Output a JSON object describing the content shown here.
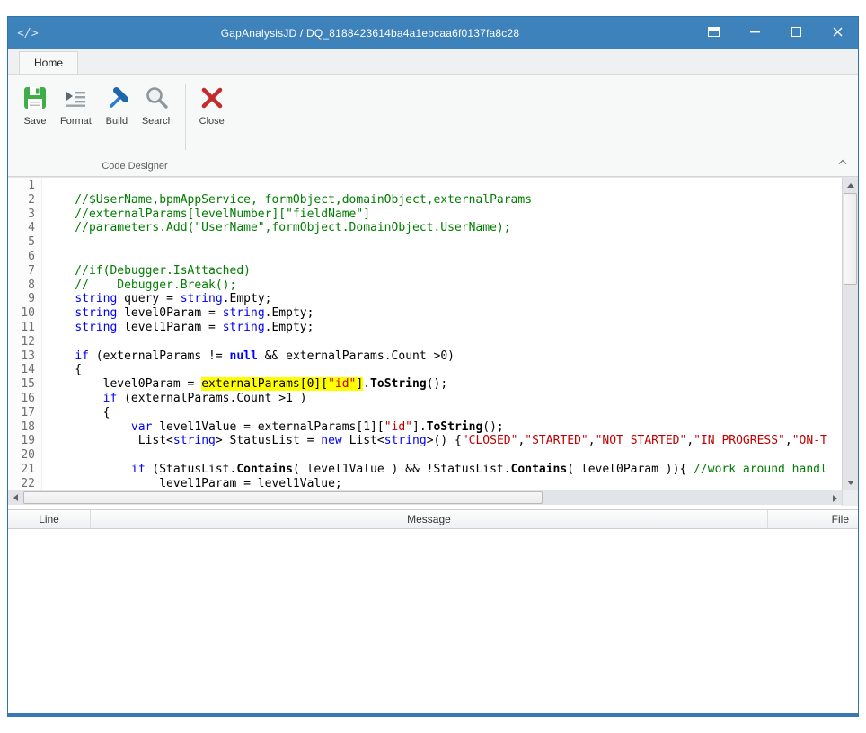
{
  "window": {
    "title": "GapAnalysisJD / DQ_8188423614ba4a1ebcaa6f0137fa8c28",
    "app_icon": "code-glyph",
    "app_icon_glyph": "</>",
    "controls": [
      {
        "name": "window-mode"
      },
      {
        "name": "minimize"
      },
      {
        "name": "maximize"
      },
      {
        "name": "close"
      }
    ]
  },
  "ribbon": {
    "tab": "Home",
    "group_label": "Code Designer",
    "buttons": [
      {
        "label": "Save",
        "icon": "floppy-disk-icon"
      },
      {
        "label": "Format",
        "icon": "format-lines-icon"
      },
      {
        "label": "Build",
        "icon": "hammer-icon"
      },
      {
        "label": "Search",
        "icon": "magnifier-icon"
      },
      {
        "label": "Close",
        "icon": "red-x-icon"
      }
    ]
  },
  "editor": {
    "highlight_color": "#ffff00",
    "lines": [
      [],
      [
        [
          "c",
          "    //$UserName,bpmAppService, formObject,domainObject,externalParams"
        ]
      ],
      [
        [
          "c",
          "    //externalParams[levelNumber][\"fieldName\"]"
        ]
      ],
      [
        [
          "c",
          "    //parameters.Add(\"UserName\",formObject.DomainObject.UserName);"
        ]
      ],
      [],
      [],
      [
        [
          "c",
          "    //if(Debugger.IsAttached)"
        ]
      ],
      [
        [
          "c",
          "    //    Debugger.Break();"
        ]
      ],
      [
        [
          "",
          "    "
        ],
        [
          "k",
          "string"
        ],
        [
          "",
          " query = "
        ],
        [
          "k",
          "string"
        ],
        [
          "",
          ".Empty;"
        ]
      ],
      [
        [
          "",
          "    "
        ],
        [
          "k",
          "string"
        ],
        [
          "",
          " level0Param = "
        ],
        [
          "k",
          "string"
        ],
        [
          "",
          ".Empty;"
        ]
      ],
      [
        [
          "",
          "    "
        ],
        [
          "k",
          "string"
        ],
        [
          "",
          " level1Param = "
        ],
        [
          "k",
          "string"
        ],
        [
          "",
          ".Empty;"
        ]
      ],
      [],
      [
        [
          "",
          "    "
        ],
        [
          "k",
          "if"
        ],
        [
          "",
          " (externalParams != "
        ],
        [
          "kb",
          "null"
        ],
        [
          "",
          " && externalParams.Count >0)"
        ]
      ],
      [
        [
          "",
          "    {"
        ]
      ],
      [
        [
          "",
          "        level0Param = "
        ],
        [
          "h",
          "externalParams[0]["
        ],
        [
          "hs",
          "\"id\""
        ],
        [
          "h",
          "]"
        ],
        [
          "",
          "."
        ],
        [
          "m",
          "ToString"
        ],
        [
          "",
          "();"
        ]
      ],
      [
        [
          "",
          "        "
        ],
        [
          "k",
          "if"
        ],
        [
          "",
          " (externalParams.Count >1 )"
        ]
      ],
      [
        [
          "",
          "        {"
        ]
      ],
      [
        [
          "",
          "            "
        ],
        [
          "k",
          "var"
        ],
        [
          "",
          " level1Value = externalParams[1]["
        ],
        [
          "s",
          "\"id\""
        ],
        [
          "",
          "]."
        ],
        [
          "m",
          "ToString"
        ],
        [
          "",
          "();"
        ]
      ],
      [
        [
          "",
          "             List<"
        ],
        [
          "k",
          "string"
        ],
        [
          "",
          "> StatusList = "
        ],
        [
          "k",
          "new"
        ],
        [
          "",
          " List<"
        ],
        [
          "k",
          "string"
        ],
        [
          "",
          ">() {"
        ],
        [
          "s",
          "\"CLOSED\""
        ],
        [
          "",
          ","
        ],
        [
          "s",
          "\"STARTED\""
        ],
        [
          "",
          ","
        ],
        [
          "s",
          "\"NOT_STARTED\""
        ],
        [
          "",
          ","
        ],
        [
          "s",
          "\"IN_PROGRESS\""
        ],
        [
          "",
          ","
        ],
        [
          "s",
          "\"ON-T"
        ]
      ],
      [],
      [
        [
          "",
          "            "
        ],
        [
          "k",
          "if"
        ],
        [
          "",
          " (StatusList."
        ],
        [
          "m",
          "Contains"
        ],
        [
          "",
          "( level1Value ) && !StatusList."
        ],
        [
          "m",
          "Contains"
        ],
        [
          "",
          "( level0Param )){ "
        ],
        [
          "c",
          "//work around handl"
        ]
      ],
      [
        [
          "",
          "                level1Param = level1Value;"
        ]
      ]
    ]
  },
  "error_panel": {
    "columns": [
      "Line",
      "Message",
      "File"
    ]
  },
  "colors": {
    "titlebar": "#3e82bb",
    "window_border": "#2f74b0",
    "keyword": "#0000ff",
    "comment": "#007d00",
    "string_literal": "#c00000",
    "search_highlight": "#ffff00"
  }
}
